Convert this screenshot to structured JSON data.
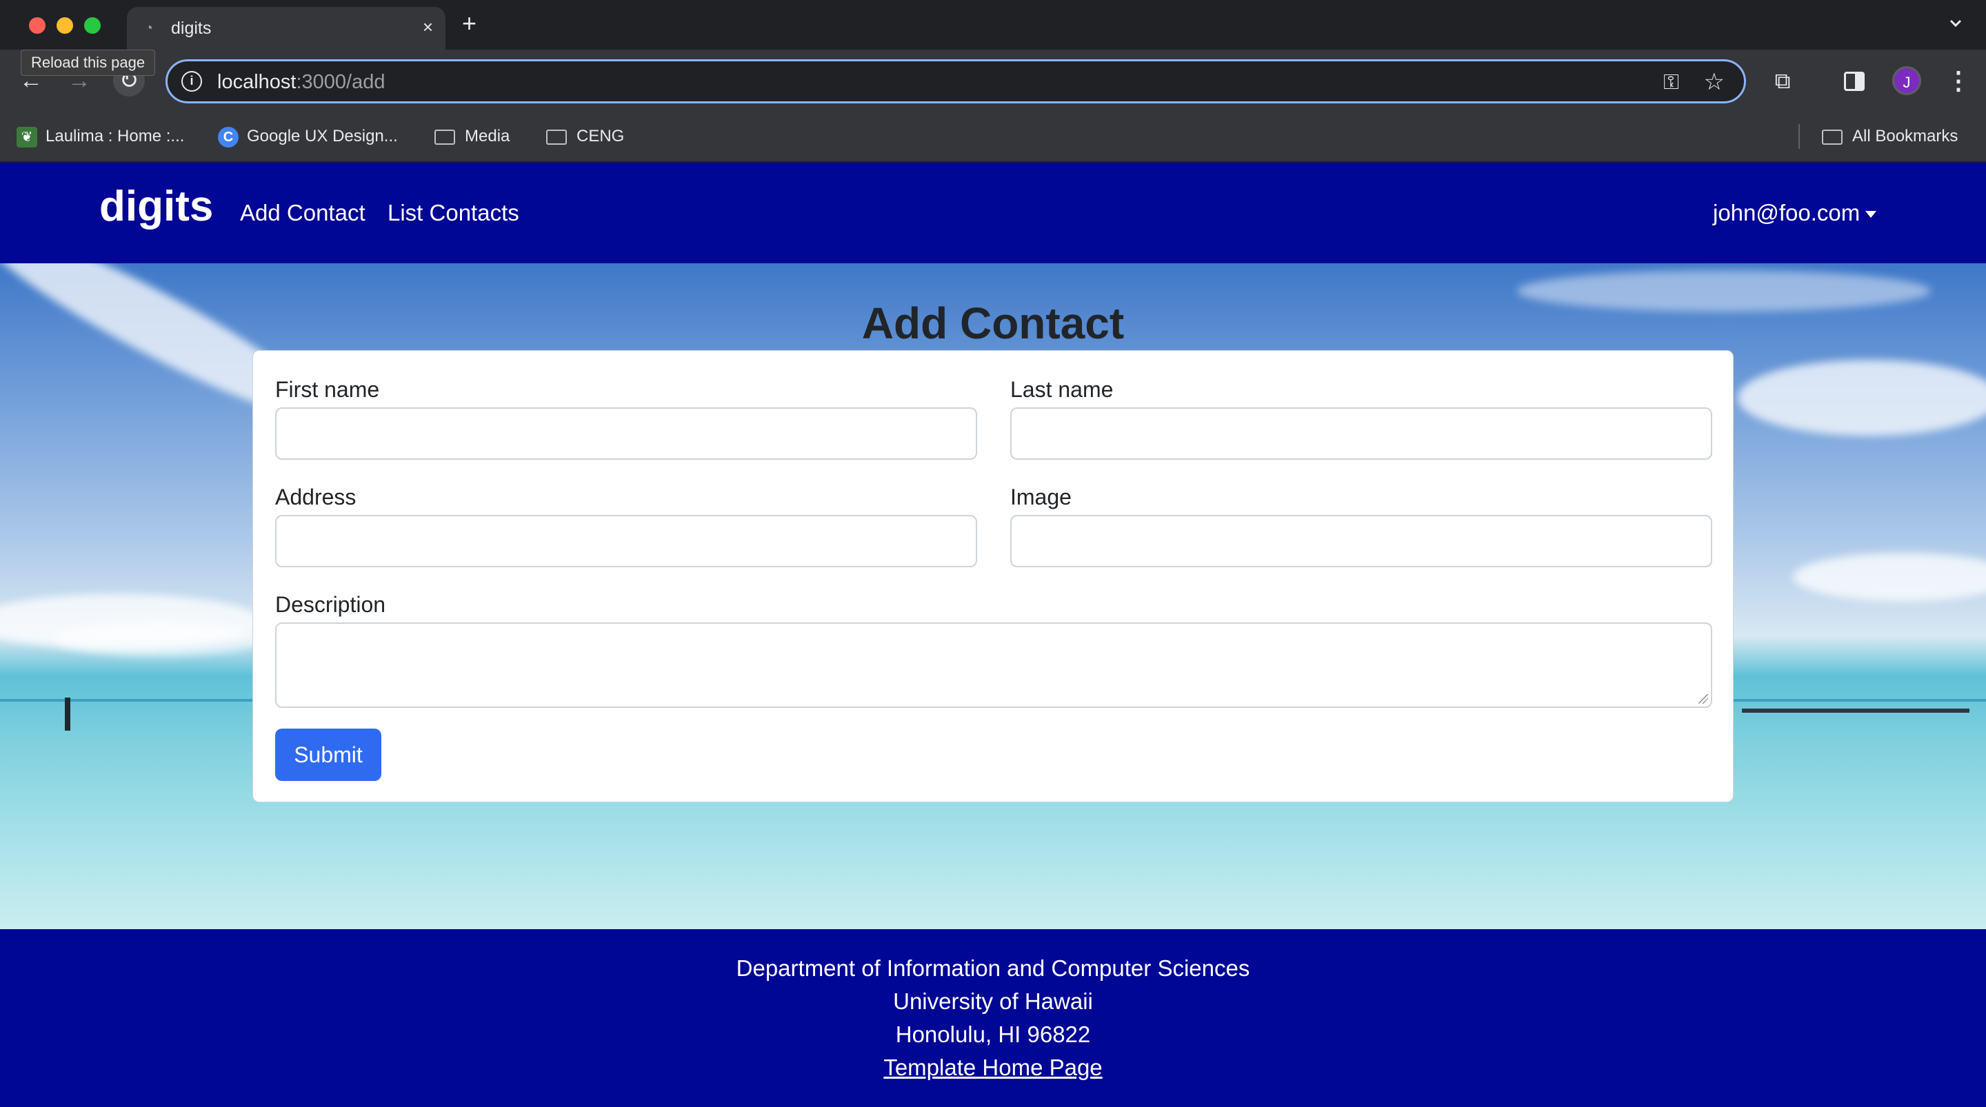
{
  "browser": {
    "tab_title": "digits",
    "tab_close": "×",
    "new_tab": "+",
    "tooltip": "Reload this page",
    "url_host": "localhost",
    "url_path": ":3000/add",
    "avatar_letter": "J",
    "bookmarks": [
      {
        "label": "Laulima : Home :...",
        "icon": "leaf-icon"
      },
      {
        "label": "Google UX Design...",
        "icon": "google-icon"
      },
      {
        "label": "Media",
        "icon": "folder-icon"
      },
      {
        "label": "CENG",
        "icon": "folder-icon"
      }
    ],
    "all_bookmarks": "All Bookmarks"
  },
  "navbar": {
    "brand": "digits",
    "links": [
      "Add Contact",
      "List Contacts"
    ],
    "user": "john@foo.com",
    "color": "#000795"
  },
  "form": {
    "title": "Add Contact",
    "fields": {
      "first_name": {
        "label": "First name",
        "value": ""
      },
      "last_name": {
        "label": "Last name",
        "value": ""
      },
      "address": {
        "label": "Address",
        "value": ""
      },
      "image": {
        "label": "Image",
        "value": ""
      },
      "description": {
        "label": "Description",
        "value": ""
      }
    },
    "submit_label": "Submit",
    "submit_color": "#2f6bf0"
  },
  "footer": {
    "line1": "Department of Information and Computer Sciences",
    "line2": "University of Hawaii",
    "line3": "Honolulu, HI 96822",
    "link": "Template Home Page"
  }
}
